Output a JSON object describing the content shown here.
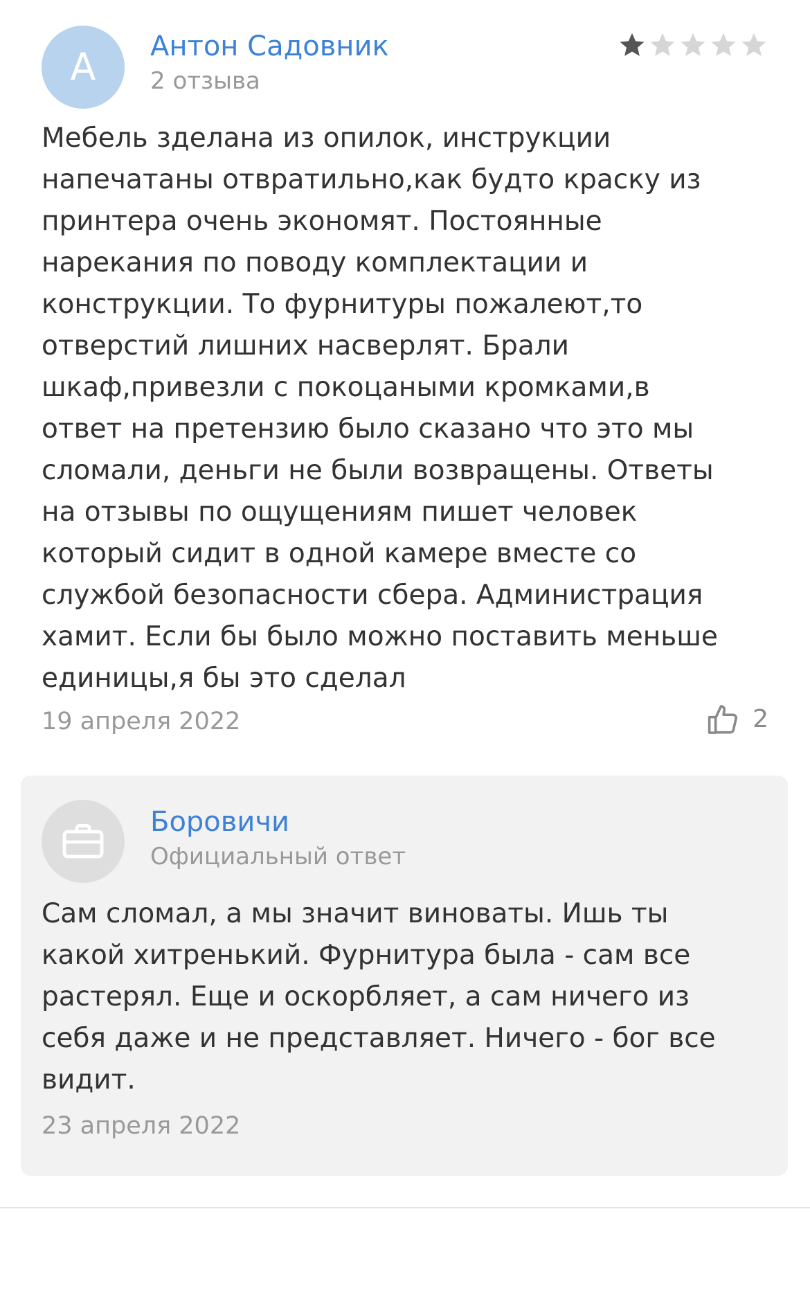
{
  "review": {
    "avatar_letter": "А",
    "author_name": "Антон Садовник",
    "author_reviews": "2 отзыва",
    "rating": 1,
    "rating_max": 5,
    "text": "Мебель зделана из опилок, инструкции\nнапечатаны отвратильно,как будто краску из\nпринтера очень экономят. Постоянные\nнарекания по поводу комплектации и\nконструкции. То фурнитуры пожалеют,то\nотверстий лишних насверлят. Брали\nшкаф,привезли с покоцаными кромками,в\nответ на претензию было сказано что это мы\nсломали, деньги не были возвращены. Ответы\nна отзывы по ощущениям пишет человек\nкоторый сидит в одной камере вместе со\nслужбой безопасности сбера. Администрация\nхамит. Если бы было можно поставить меньше\nединицы,я бы это сделал",
    "date": "19 апреля 2022",
    "likes": "2",
    "like_icon": "thumbs-up-icon"
  },
  "answer": {
    "avatar_icon": "briefcase-icon",
    "name": "Боровичи",
    "label": "Официальный ответ",
    "text": "Сам сломал, а мы значит виноваты. Ишь ты\nкакой хитренький. Фурнитура была - сам все\nрастерял. Еще и оскорбляет, а сам ничего из\nсебя даже и не представляет. Ничего - бог все\nвидит.",
    "date": "23 апреля 2022"
  },
  "colors": {
    "link": "#3d82d6",
    "muted": "#999999",
    "star_filled": "#555555",
    "star_empty": "#d6d6d6",
    "answer_bg": "#f2f2f2"
  }
}
